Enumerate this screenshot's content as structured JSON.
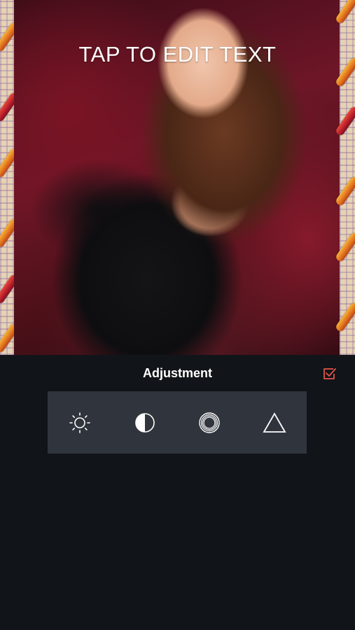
{
  "canvas": {
    "overlay_text": "TAP TO EDIT TEXT"
  },
  "panel": {
    "title": "Adjustment",
    "confirm_icon": "checkbox-check-icon",
    "accent_color": "#e0554a"
  },
  "tools": [
    {
      "icon": "brightness-icon"
    },
    {
      "icon": "contrast-icon"
    },
    {
      "icon": "vignette-icon"
    },
    {
      "icon": "sharpen-triangle-icon"
    }
  ],
  "colors": {
    "background": "#111418",
    "toolbar": "#30343d",
    "text": "#ffffff"
  }
}
